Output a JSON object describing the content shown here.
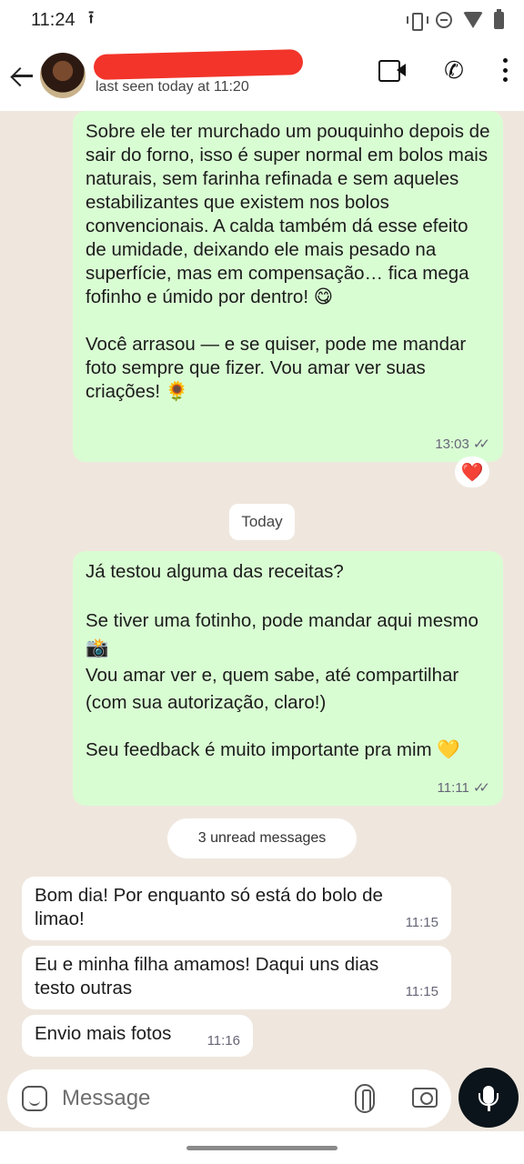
{
  "status_bar": {
    "time": "11:24",
    "icons": [
      "upload-icon",
      "vibrate-icon",
      "do-not-disturb-icon",
      "wifi-icon",
      "battery-icon"
    ]
  },
  "header": {
    "contact_name": "",
    "last_seen": "last seen today at 11:20",
    "actions": [
      "video-call-icon",
      "phone-call-icon",
      "more-options-icon"
    ]
  },
  "messages": [
    {
      "direction": "outgoing",
      "paragraphs": [
        "Sobre ele ter murchado um pouquinho depois de sair do forno, isso é super normal em bolos mais naturais, sem farinha refinada e sem aqueles estabilizantes que existem nos bolos convencionais. A calda também dá esse efeito de umidade, deixando ele mais pesado na superfície, mas em compensação… fica mega fofinho e úmido por dentro! 😋",
        "Você arrasou — e se quiser, pode me mandar foto sempre que fizer. Vou amar ver suas criações! 🌻"
      ],
      "time": "13:03",
      "ticks": "✓✓",
      "reaction": "❤️"
    },
    {
      "direction": "outgoing",
      "paragraphs": [
        "Já testou alguma das receitas?",
        "Se tiver uma fotinho, pode mandar aqui mesmo 📸\nVou amar ver e, quem sabe, até compartilhar (com sua autorização, claro!)",
        "Seu feedback é muito importante pra mim 💛"
      ],
      "time": "11:11",
      "ticks": "✓✓"
    },
    {
      "direction": "incoming",
      "text": "Bom dia! Por enquanto só está do bolo de limao!",
      "time": "11:15"
    },
    {
      "direction": "incoming",
      "text": "Eu e minha filha amamos! Daqui uns dias testo outras",
      "time": "11:15"
    },
    {
      "direction": "incoming",
      "text": "Envio mais fotos",
      "time": "11:16"
    }
  ],
  "date_chip": "Today",
  "unread_chip": "3 unread messages",
  "composer": {
    "placeholder": "Message",
    "icons": [
      "sticker-icon",
      "attach-icon",
      "camera-icon",
      "mic-icon"
    ]
  },
  "colors": {
    "outgoing_bubble": "#d9fdd3",
    "incoming_bubble": "#ffffff",
    "chat_background": "#efe7de",
    "mic_button": "#0b141a",
    "redaction": "#f2342a"
  }
}
